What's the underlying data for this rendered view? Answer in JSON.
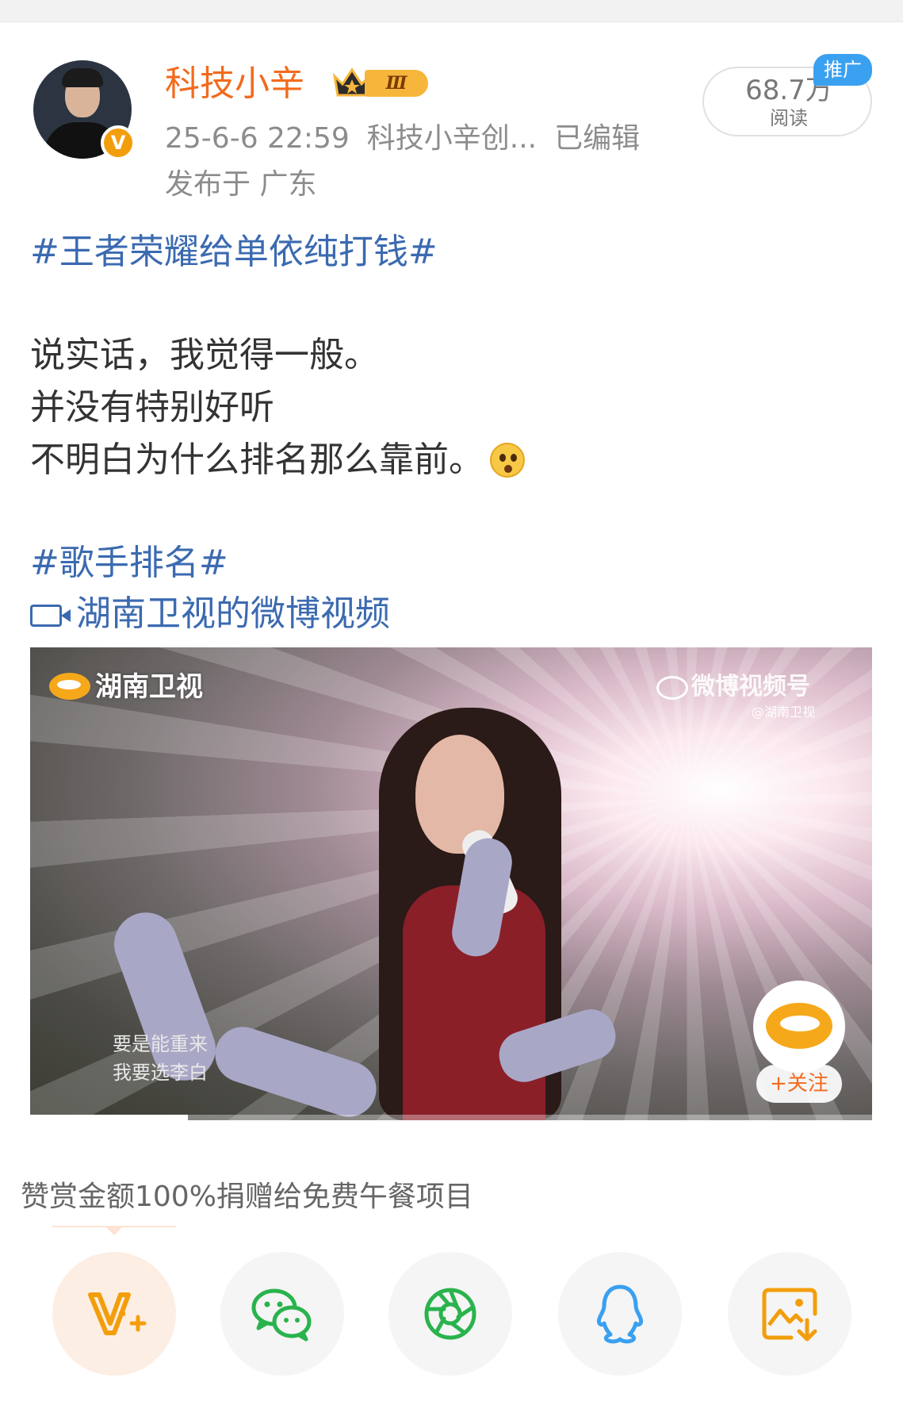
{
  "post": {
    "author": {
      "name": "科技小辛",
      "vip_level": "Ⅲ",
      "verified_mark": "V"
    },
    "meta": {
      "time": "25-6-6 22:59",
      "source": "科技小辛创...",
      "edited": "已编辑",
      "location": "发布于 广东"
    },
    "reads": {
      "count": "68.7万",
      "label": "阅读",
      "promo_tag": "推广"
    },
    "topic_1": "#王者荣耀给单依纯打钱#",
    "lines": [
      "说实话，我觉得一般。",
      "并没有特别好听",
      "不明白为什么排名那么靠前。"
    ],
    "topic_2": "#歌手排名#",
    "video_link": "湖南卫视的微博视频"
  },
  "video": {
    "channel_logo_text": "湖南卫视",
    "watermark_text": "微博视频号",
    "watermark_handle": "@湖南卫视",
    "lyrics": [
      "要是能重来",
      "我要选李白"
    ],
    "follow_label": "+关注",
    "progress": 0.187
  },
  "donate": {
    "text": "赞赏金额100%捐赠给免费午餐项目"
  },
  "share_bar": {
    "items": [
      "v-plus-icon",
      "wechat-icon",
      "moments-icon",
      "qq-icon",
      "save-image-icon"
    ]
  },
  "colors": {
    "username": "#f26b1d",
    "topic": "#3b6ab0",
    "meta": "#8c8c8c",
    "promo": "#3aa0f0",
    "wechat": "#2ab34d",
    "moments": "#2ab34d",
    "qq": "#3aa0f0",
    "save": "#f29e0c"
  }
}
